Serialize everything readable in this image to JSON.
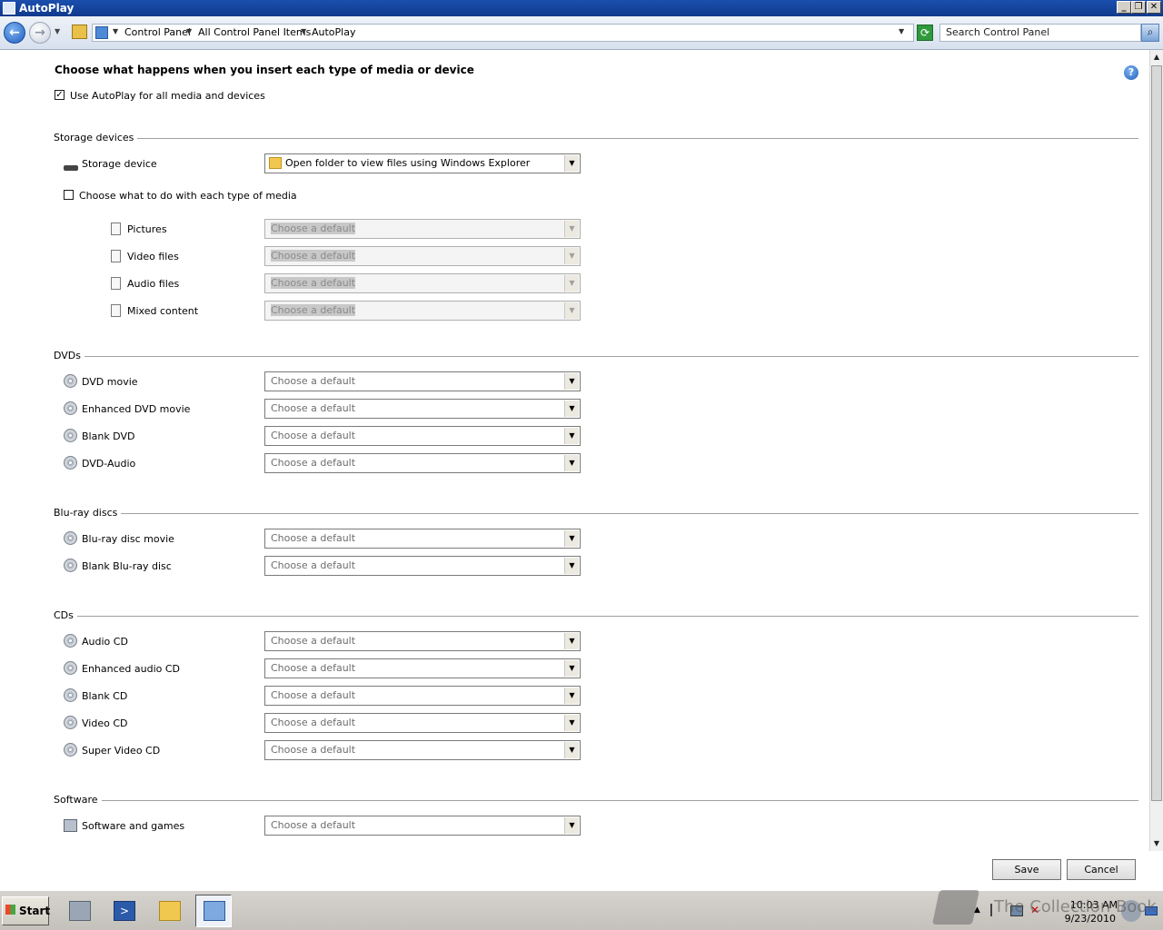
{
  "window": {
    "title": "AutoPlay"
  },
  "address": {
    "crumbs": [
      "Control Panel",
      "All Control Panel Items",
      "AutoPlay"
    ],
    "search_placeholder": "Search Control Panel"
  },
  "main": {
    "heading": "Choose what happens when you insert each type of media or device",
    "use_autoplay_label": "Use AutoPlay for all media and devices",
    "use_autoplay_checked": true,
    "storage": {
      "title": "Storage devices",
      "device_label": "Storage device",
      "device_value": "Open folder to view files using Windows Explorer",
      "choose_each_label": "Choose what to do with each type of media",
      "choose_each_checked": false,
      "pictures": "Pictures",
      "video": "Video files",
      "audio": "Audio files",
      "mixed": "Mixed content"
    },
    "dvds": {
      "title": "DVDs",
      "dvd_movie": "DVD movie",
      "enhanced_dvd": "Enhanced DVD movie",
      "blank_dvd": "Blank DVD",
      "dvd_audio": "DVD-Audio"
    },
    "bluray": {
      "title": "Blu-ray discs",
      "movie": "Blu-ray disc movie",
      "blank": "Blank Blu-ray disc"
    },
    "cds": {
      "title": "CDs",
      "audio_cd": "Audio CD",
      "enhanced_audio": "Enhanced audio CD",
      "blank_cd": "Blank CD",
      "video_cd": "Video CD",
      "super_video_cd": "Super Video CD"
    },
    "software": {
      "title": "Software",
      "games": "Software and games"
    },
    "default_option": "Choose a default",
    "save": "Save",
    "cancel": "Cancel"
  },
  "taskbar": {
    "start": "Start",
    "time": "10:03 AM",
    "date": "9/23/2010"
  },
  "watermark": "The Collection Book"
}
